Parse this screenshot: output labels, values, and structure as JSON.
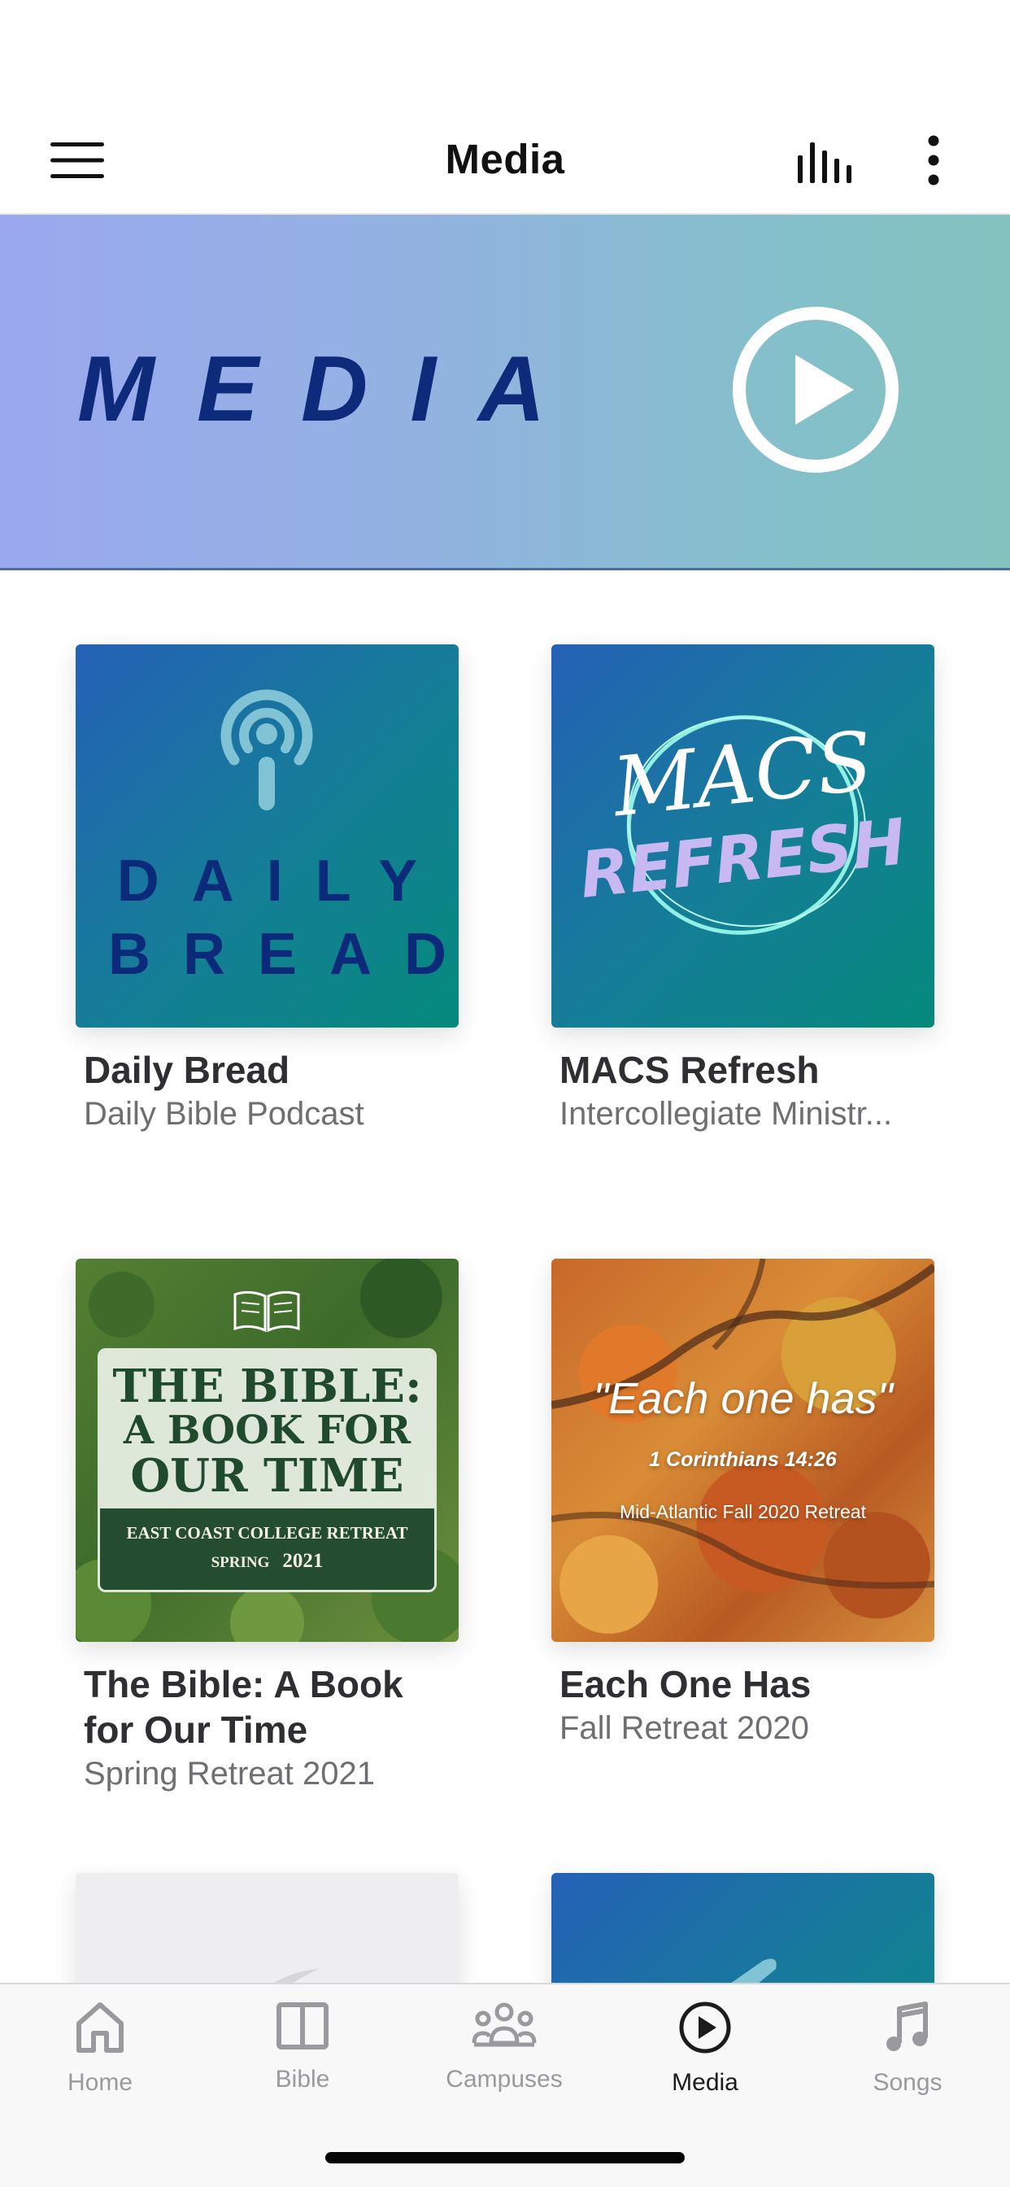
{
  "header": {
    "title": "Media",
    "menu_icon": "hamburger-menu-icon",
    "audio_icon": "audio-levels-icon",
    "more_icon": "vertical-ellipsis-icon"
  },
  "hero": {
    "word": "MEDIA",
    "play_icon": "play-circle-icon",
    "colors": {
      "gradient_start": "#9aa8ef",
      "gradient_end": "#82c3be",
      "text": "#0e2a7a"
    }
  },
  "cards": [
    {
      "title": "Daily Bread",
      "subtitle": "Daily Bible Podcast",
      "art": {
        "line1": "DAILY",
        "line2": "BREAD",
        "icon": "podcast-icon"
      }
    },
    {
      "title": "MACS Refresh",
      "subtitle": "Intercollegiate Ministr...",
      "art": {
        "line1": "MACS",
        "line2": "REFRESH"
      }
    },
    {
      "title": "The Bible: A Book for Our Time",
      "subtitle": "Spring Retreat 2021",
      "art": {
        "line1": "THE BIBLE:",
        "line2": "A BOOK FOR",
        "line3": "OUR TIME",
        "line4": "EAST COAST COLLEGE RETREAT",
        "line5": "SPRING",
        "line6": "2021",
        "icon": "open-book-icon"
      }
    },
    {
      "title": "Each One Has",
      "subtitle": "Fall Retreat 2020",
      "art": {
        "line1": "\"Each one has\"",
        "line2": "1 Corinthians 14:26",
        "line3": "Mid-Atlantic Fall 2020 Retreat"
      }
    }
  ],
  "tabs": [
    {
      "label": "Home",
      "icon": "home-icon",
      "active": false
    },
    {
      "label": "Bible",
      "icon": "book-icon",
      "active": false
    },
    {
      "label": "Campuses",
      "icon": "people-group-icon",
      "active": false
    },
    {
      "label": "Media",
      "icon": "play-circle-icon",
      "active": true
    },
    {
      "label": "Songs",
      "icon": "music-note-icon",
      "active": false
    }
  ],
  "colors": {
    "active_tab": "#1c1c1e",
    "inactive_tab": "#9a9a9e",
    "teal_gradient_start": "#2461b6",
    "teal_gradient_end": "#05897c"
  }
}
